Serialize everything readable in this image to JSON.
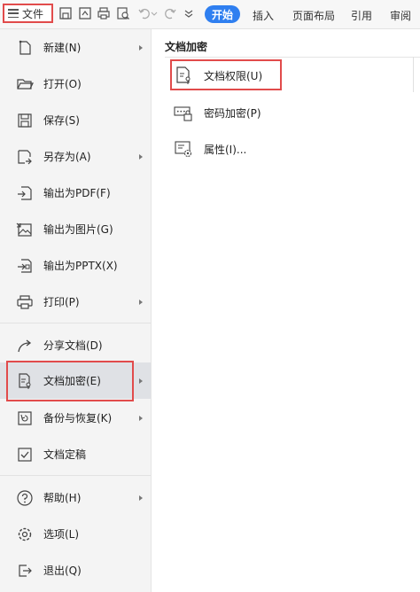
{
  "toolbar": {
    "file_label": "文件",
    "tabs": [
      "开始",
      "插入",
      "页面布局",
      "引用",
      "审阅"
    ],
    "accent_color": "#2f7ff0"
  },
  "left_menu": {
    "items": [
      {
        "label": "新建(N)",
        "icon": "new-file-icon",
        "has_submenu": true
      },
      {
        "label": "打开(O)",
        "icon": "folder-open-icon",
        "has_submenu": false
      },
      {
        "label": "保存(S)",
        "icon": "save-icon",
        "has_submenu": false
      },
      {
        "label": "另存为(A)",
        "icon": "save-as-icon",
        "has_submenu": true
      },
      {
        "label": "输出为PDF(F)",
        "icon": "export-pdf-icon",
        "has_submenu": false
      },
      {
        "label": "输出为图片(G)",
        "icon": "export-image-icon",
        "has_submenu": false
      },
      {
        "label": "输出为PPTX(X)",
        "icon": "export-pptx-icon",
        "has_submenu": false
      },
      {
        "label": "打印(P)",
        "icon": "print-icon",
        "has_submenu": true
      },
      {
        "label": "分享文档(D)",
        "icon": "share-icon",
        "has_submenu": false
      },
      {
        "label": "文档加密(E)",
        "icon": "encrypt-doc-icon",
        "has_submenu": true,
        "active": true
      },
      {
        "label": "备份与恢复(K)",
        "icon": "backup-icon",
        "has_submenu": true
      },
      {
        "label": "文档定稿",
        "icon": "finalize-icon",
        "has_submenu": false
      },
      {
        "label": "帮助(H)",
        "icon": "help-icon",
        "has_submenu": true
      },
      {
        "label": "选项(L)",
        "icon": "settings-icon",
        "has_submenu": false
      },
      {
        "label": "退出(Q)",
        "icon": "exit-icon",
        "has_submenu": false
      }
    ]
  },
  "submenu": {
    "title": "文档加密",
    "items": [
      {
        "label": "文档权限(U)",
        "icon": "doc-permission-icon"
      },
      {
        "label": "密码加密(P)",
        "icon": "password-lock-icon"
      },
      {
        "label": "属性(I)...",
        "icon": "properties-icon"
      }
    ]
  },
  "highlight_color": "#e14b4b"
}
